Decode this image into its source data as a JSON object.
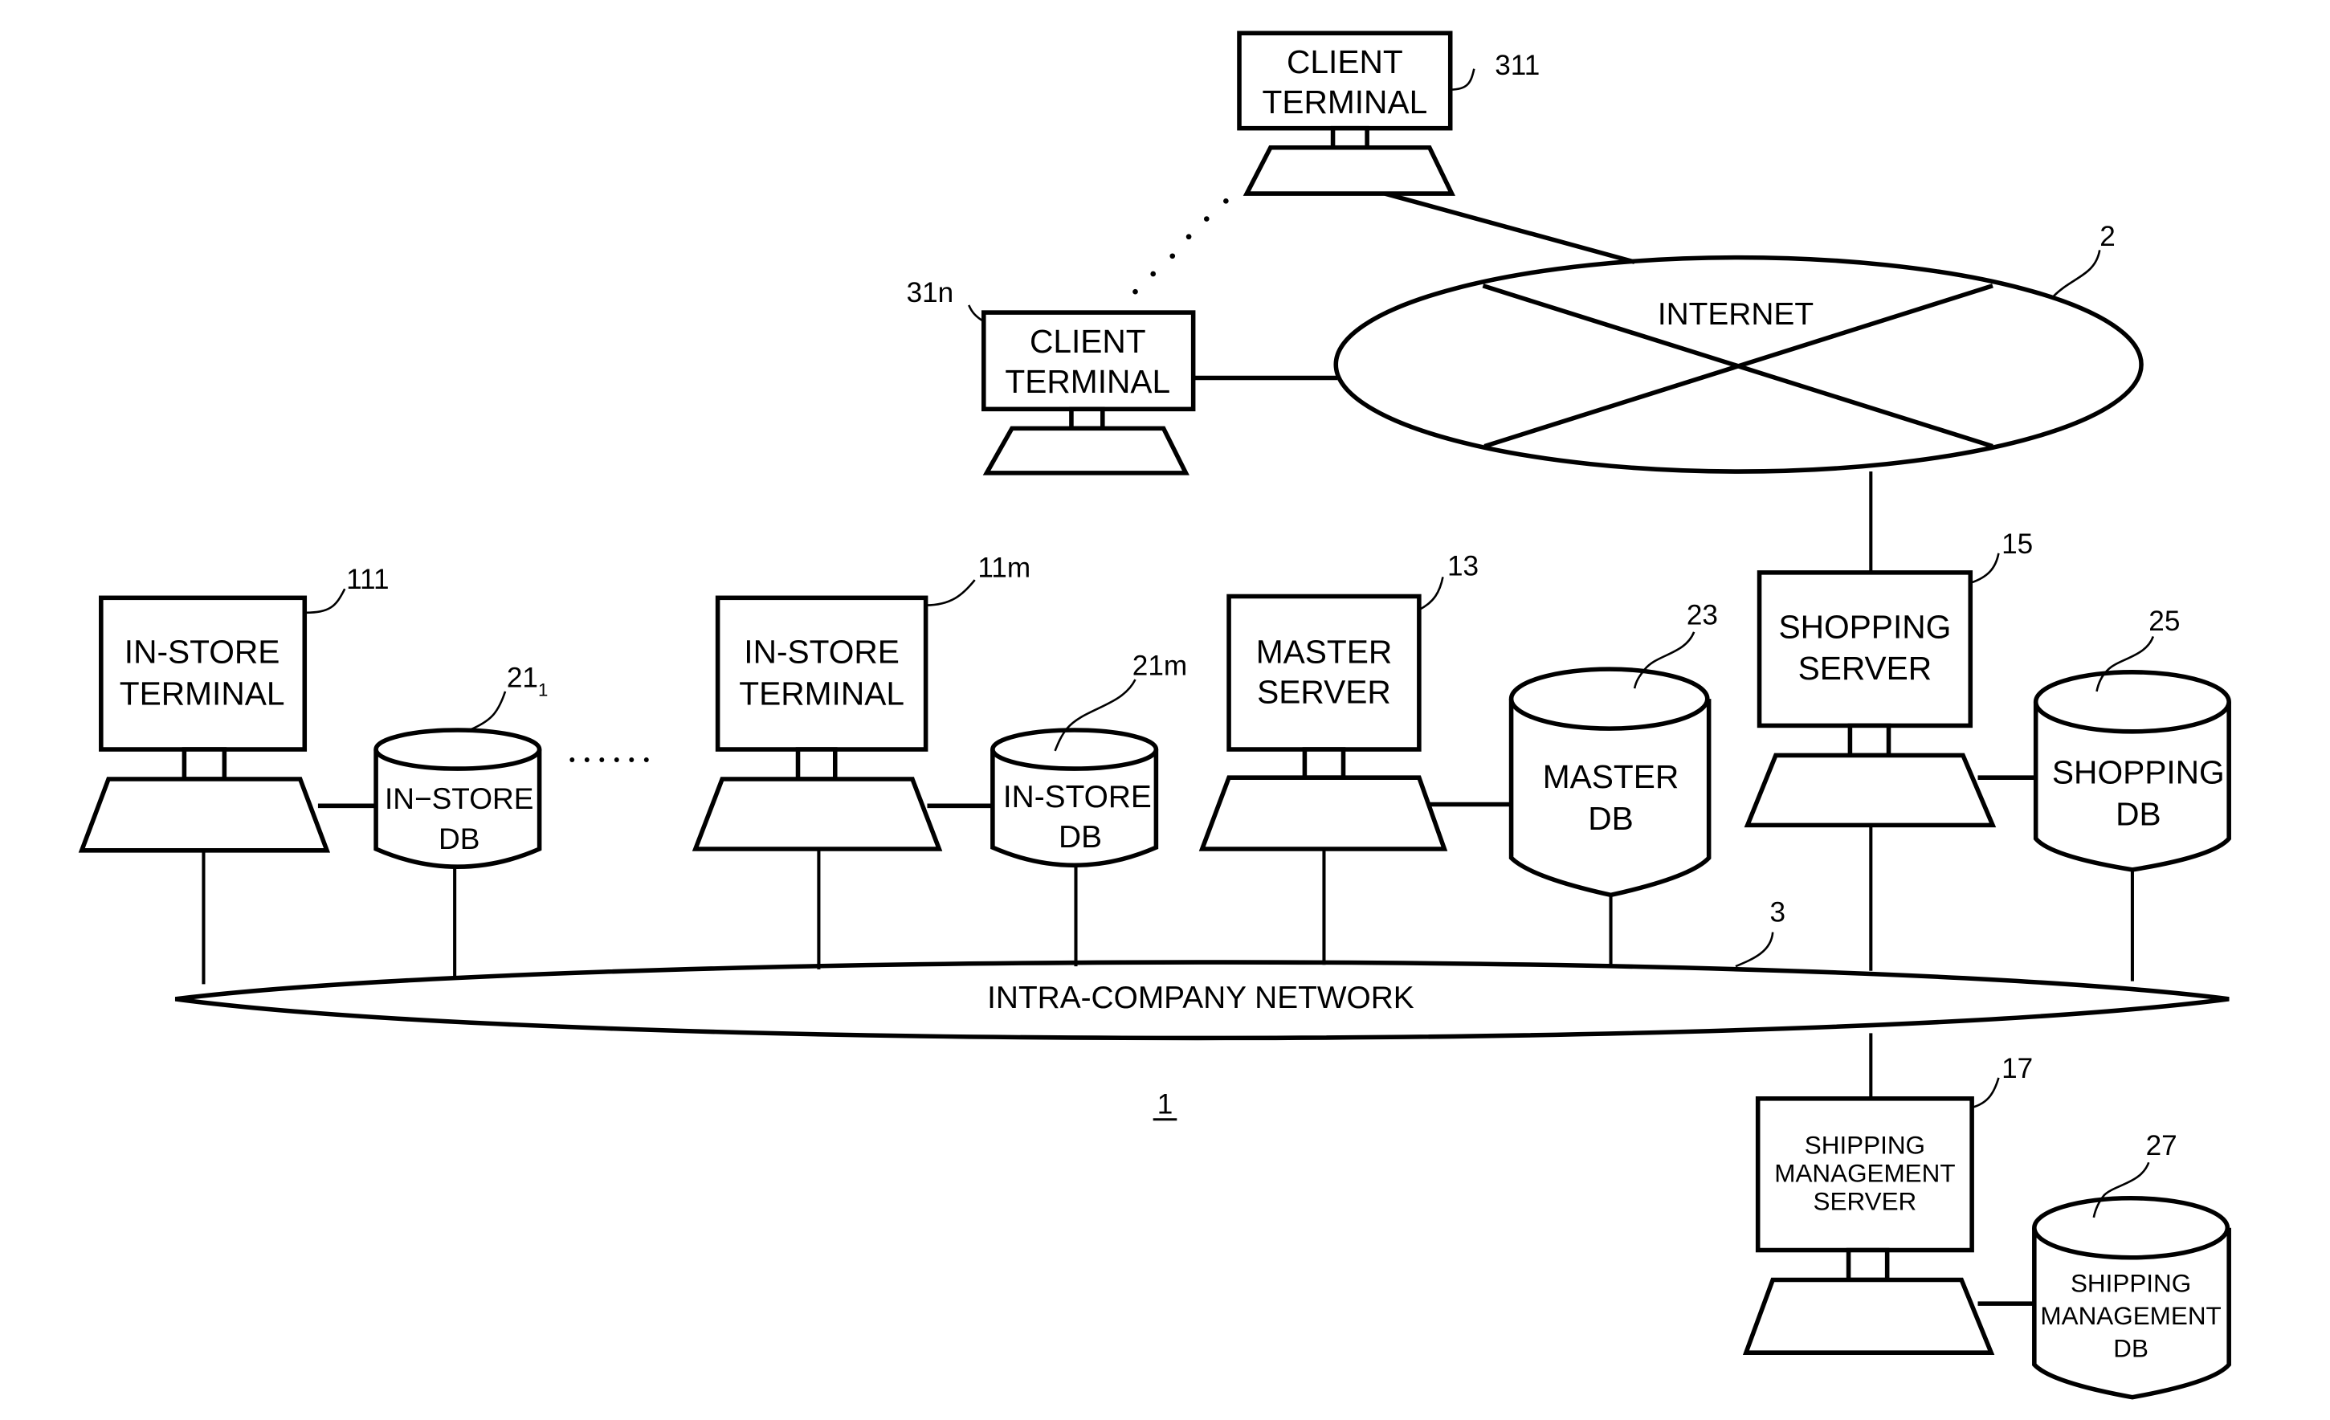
{
  "figure": {
    "system_ref": "1",
    "networks": {
      "internet": {
        "label": "INTERNET",
        "ref": "2"
      },
      "intra": {
        "label": "INTRA-COMPANY NETWORK",
        "ref": "3"
      }
    },
    "client_terminals": [
      {
        "line1": "CLIENT",
        "line2": "TERMINAL",
        "ref": "311"
      },
      {
        "line1": "CLIENT",
        "line2": "TERMINAL",
        "ref": "31n"
      }
    ],
    "in_store_terminals": [
      {
        "line1": "IN-STORE",
        "line2": "TERMINAL",
        "ref": "111"
      },
      {
        "line1": "IN-STORE",
        "line2": "TERMINAL",
        "ref": "11m"
      }
    ],
    "in_store_dbs": [
      {
        "line1": "IN−STORE",
        "line2": "DB",
        "ref_main": "21",
        "ref_sub": "1"
      },
      {
        "line1": "IN-STORE",
        "line2": "DB",
        "ref": "21m"
      }
    ],
    "master_server": {
      "line1": "MASTER",
      "line2": "SERVER",
      "ref": "13"
    },
    "master_db": {
      "line1": "MASTER",
      "line2": "DB",
      "ref": "23"
    },
    "shopping_server": {
      "line1": "SHOPPING",
      "line2": "SERVER",
      "ref": "15"
    },
    "shopping_db": {
      "line1": "SHOPPING",
      "line2": "DB",
      "ref": "25"
    },
    "shipping_server": {
      "line1": "SHIPPING",
      "line2": "MANAGEMENT",
      "line3": "SERVER",
      "ref": "17"
    },
    "shipping_db": {
      "line1": "SHIPPING",
      "line2": "MANAGEMENT",
      "line3": "DB",
      "ref": "27"
    }
  }
}
